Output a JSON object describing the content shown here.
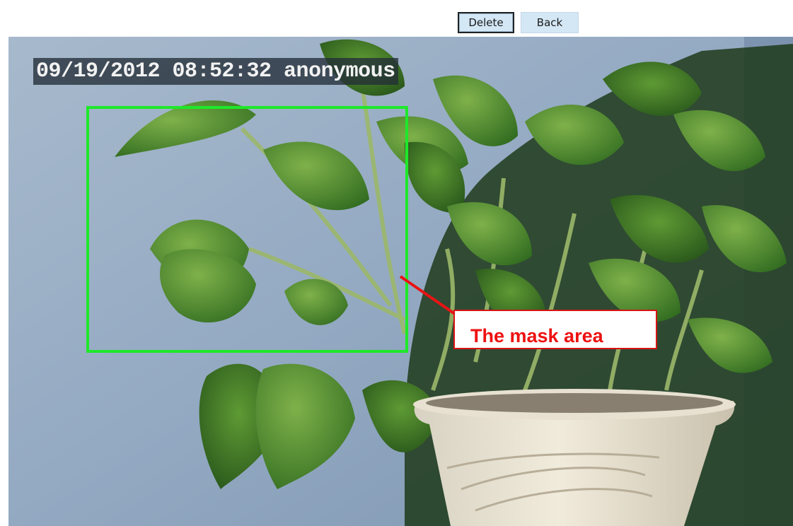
{
  "toolbar": {
    "delete_label": "Delete",
    "back_label": "Back"
  },
  "video": {
    "osd_text": "09/19/2012 08:52:32 anonymous"
  },
  "annotation": {
    "callout_text": "The mask area"
  },
  "colors": {
    "mask_border": "#1ee82a",
    "callout_text": "#ee1111",
    "callout_border": "#d81414",
    "button_bg": "#d3e7f5"
  },
  "icons": {
    "arrow": "red-arrow-icon"
  }
}
